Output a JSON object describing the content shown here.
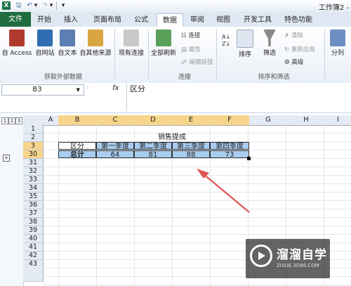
{
  "window": {
    "title": "工作簿2 -"
  },
  "quick_access": {
    "logo": "X",
    "save_icon": "save-icon",
    "undo_icon": "undo-icon",
    "redo_icon": "redo-icon"
  },
  "tabs": [
    {
      "label": "文件"
    },
    {
      "label": "开始"
    },
    {
      "label": "插入"
    },
    {
      "label": "页面布局"
    },
    {
      "label": "公式"
    },
    {
      "label": "数据"
    },
    {
      "label": "审阅"
    },
    {
      "label": "视图"
    },
    {
      "label": "开发工具"
    },
    {
      "label": "特色功能"
    }
  ],
  "ribbon": {
    "get_external": {
      "group_label": "获取外部数据",
      "buttons": [
        {
          "label": "自 Access",
          "color": "#b03a2e"
        },
        {
          "label": "自网站",
          "color": "#2e6db0"
        },
        {
          "label": "自文本",
          "color": "#5b7fb0"
        },
        {
          "label": "自其他来源",
          "color": "#d9a441"
        }
      ]
    },
    "existing": {
      "label": "现有连接"
    },
    "connections": {
      "group_label": "连接",
      "refresh_label": "全部刷新",
      "items": [
        "连接",
        "属性",
        "编辑链接"
      ]
    },
    "sort_filter": {
      "group_label": "排序和筛选",
      "sort_label": "排序",
      "filter_label": "筛选",
      "items": [
        "清除",
        "重新应用",
        "高级"
      ]
    },
    "outline": {
      "label": "分列"
    }
  },
  "formula_bar": {
    "name_box": "B3",
    "fx": "fx",
    "formula": "区分"
  },
  "outline_levels": [
    "1",
    "2",
    "3"
  ],
  "columns": [
    "A",
    "B",
    "C",
    "D",
    "E",
    "F",
    "G",
    "H",
    "I"
  ],
  "rows": [
    "1",
    "2",
    "3",
    "30",
    "31",
    "32",
    "33",
    "34",
    "35",
    "36",
    "37",
    "38",
    "39",
    "40",
    "41",
    "42",
    "43"
  ],
  "sheet": {
    "title": "销售提成",
    "header": [
      "区分",
      "第一季度",
      "第二季度",
      "第三季度",
      "第四季度"
    ],
    "total_row": [
      "总计",
      "64",
      "81",
      "88",
      "73"
    ]
  },
  "colors": {
    "selection": "#a9cdf0",
    "header_highlight": "#f7d58a",
    "arrow": "#e05555"
  },
  "watermark": {
    "text": "溜溜自学",
    "url": "ZIXUE.3D66.COM"
  }
}
